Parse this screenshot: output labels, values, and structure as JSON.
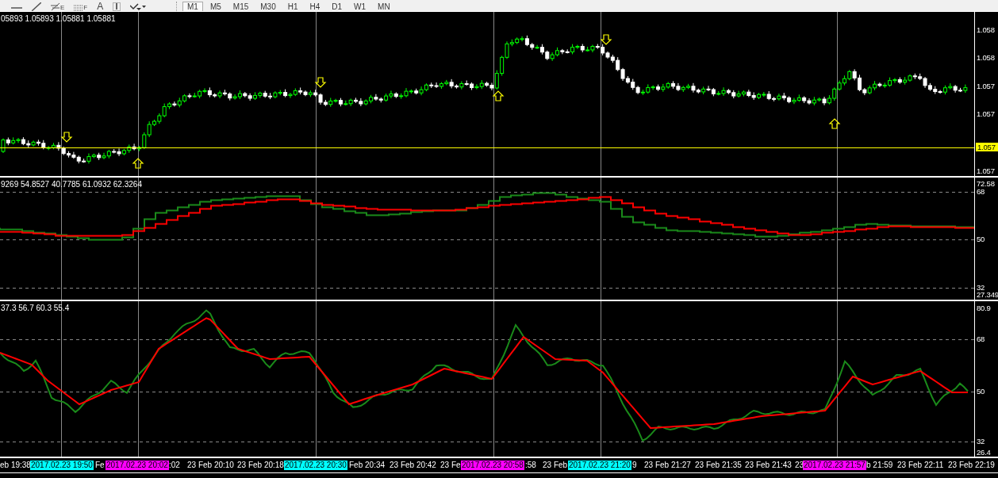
{
  "toolbar": {
    "tools": [
      {
        "kind": "horizontal-line"
      },
      {
        "kind": "trend-line"
      },
      {
        "kind": "fibo",
        "letter": "E"
      },
      {
        "kind": "fibo-grid",
        "letter": "F"
      },
      {
        "kind": "text",
        "letter": "A"
      },
      {
        "kind": "label"
      },
      {
        "kind": "arrow"
      }
    ],
    "timeframes": [
      {
        "label": "M1",
        "selected": true
      },
      {
        "label": "M5",
        "selected": false
      },
      {
        "label": "M15",
        "selected": false
      },
      {
        "label": "M30",
        "selected": false
      },
      {
        "label": "H1",
        "selected": false
      },
      {
        "label": "H4",
        "selected": false
      },
      {
        "label": "D1",
        "selected": false
      },
      {
        "label": "W1",
        "selected": false
      },
      {
        "label": "MN",
        "selected": false
      }
    ]
  },
  "main_pane": {
    "header": "05893 1.05893 1.05881 1.05881",
    "price_labels": [
      {
        "text": "1.058",
        "highlighted": false
      },
      {
        "text": "1.058",
        "highlighted": false
      },
      {
        "text": "1.057",
        "highlighted": false
      },
      {
        "text": "1.057",
        "highlighted": false
      },
      {
        "text": "1.057",
        "highlighted": true
      },
      {
        "text": "1.057",
        "highlighted": false
      }
    ]
  },
  "indicator_pane_1": {
    "header": "9269 54.8527 40.7785 61.0932 62.3264",
    "scale_labels": [
      "72.58",
      "68",
      "50",
      "32",
      "27.349"
    ]
  },
  "indicator_pane_2": {
    "header": "37.3 56.7 60.3 55.4",
    "scale_labels": [
      "80.9",
      "68",
      "50",
      "32",
      "26.4"
    ]
  },
  "time_axis": {
    "labels": [
      {
        "text": "eb 19:38",
        "kind": "time"
      },
      {
        "text": "2017.02.23 19:50",
        "kind": "marker",
        "color": "#00ffff"
      },
      {
        "text": "Fe",
        "kind": "time"
      },
      {
        "text": "2017.02.23 20:02",
        "kind": "marker",
        "color": "#ff00ff"
      },
      {
        "text": ":02",
        "kind": "time"
      },
      {
        "text": "23 Feb 20:10",
        "kind": "time"
      },
      {
        "text": "23 Feb 20:18",
        "kind": "time"
      },
      {
        "text": "2017.02.23 20:30",
        "kind": "marker",
        "color": "#00ffff"
      },
      {
        "text": "Feb 20:34",
        "kind": "time"
      },
      {
        "text": "23 Feb 20:42",
        "kind": "time"
      },
      {
        "text": "23 Fe",
        "kind": "time"
      },
      {
        "text": "2017.02.23 20:58",
        "kind": "marker",
        "color": "#ff00ff"
      },
      {
        "text": ":58",
        "kind": "time"
      },
      {
        "text": "23 Feb",
        "kind": "time"
      },
      {
        "text": "2017.02.23 21:20",
        "kind": "marker",
        "color": "#00ffff"
      },
      {
        "text": "9",
        "kind": "time"
      },
      {
        "text": "23 Feb 21:27",
        "kind": "time"
      },
      {
        "text": "23 Feb 21:35",
        "kind": "time"
      },
      {
        "text": "23 Feb 21:43",
        "kind": "time"
      },
      {
        "text": "23",
        "kind": "time"
      },
      {
        "text": "2017.02.23 21:57",
        "kind": "marker",
        "color": "#ff00ff"
      },
      {
        "text": "b 21:59",
        "kind": "time"
      },
      {
        "text": "23 Feb 22:11",
        "kind": "time"
      },
      {
        "text": "23 Feb 22:19",
        "kind": "time"
      }
    ]
  }
}
